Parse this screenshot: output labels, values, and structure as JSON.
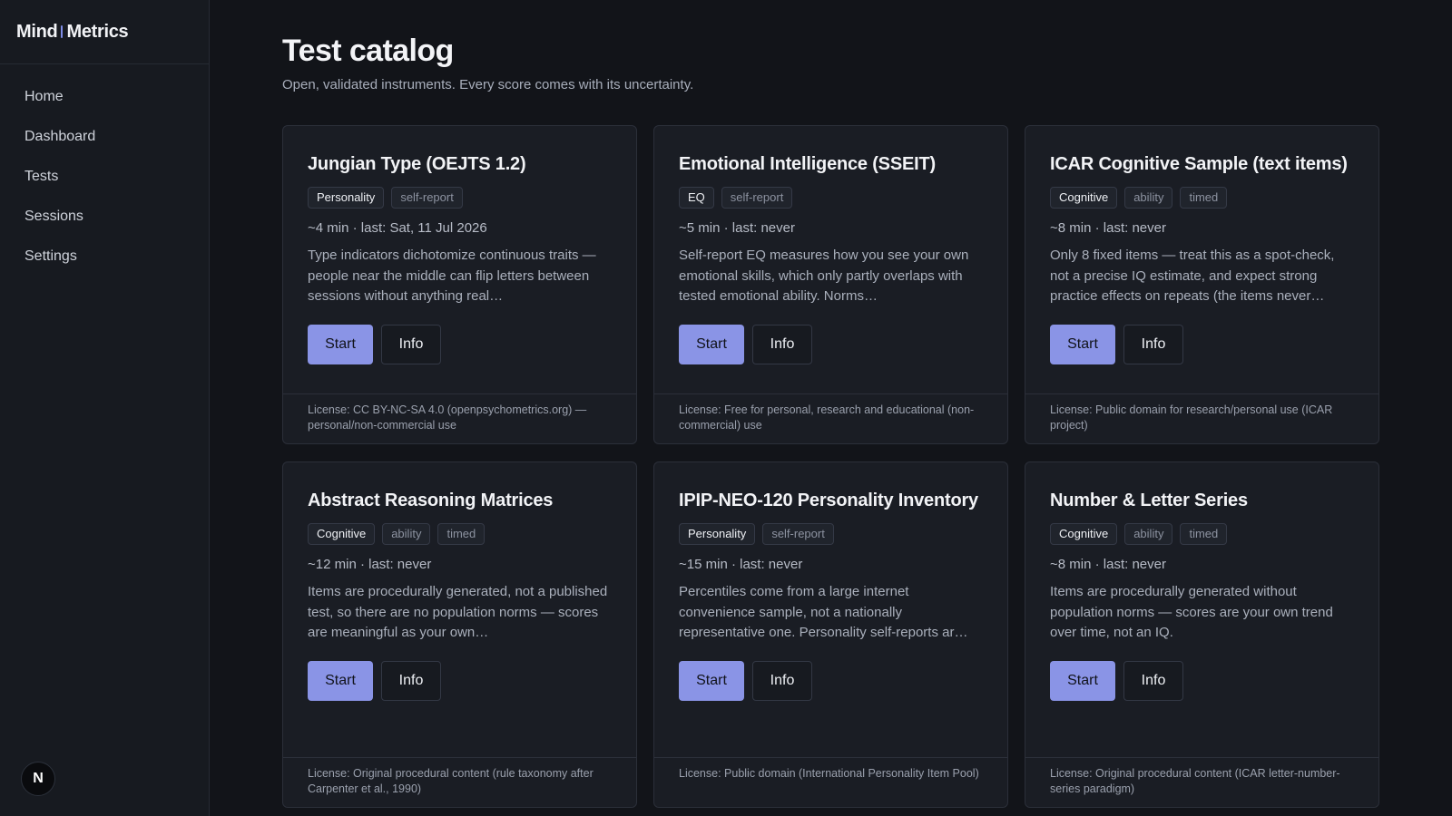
{
  "brand": {
    "part1": "Mind",
    "part2": "Metrics"
  },
  "nav": [
    {
      "label": "Home"
    },
    {
      "label": "Dashboard"
    },
    {
      "label": "Tests"
    },
    {
      "label": "Sessions"
    },
    {
      "label": "Settings"
    }
  ],
  "user": {
    "initial": "N"
  },
  "page": {
    "title": "Test catalog",
    "subtitle": "Open, validated instruments. Every score comes with its uncertainty."
  },
  "buttons": {
    "start": "Start",
    "info": "Info"
  },
  "cards": [
    {
      "title": "Jungian Type (OEJTS 1.2)",
      "tags": [
        "Personality",
        "self-report"
      ],
      "meta": "~4 min · last: Sat, 11 Jul 2026",
      "description": "Type indicators dichotomize continuous traits — people near the middle can flip letters between sessions without anything real…",
      "license": "License: CC BY-NC-SA 4.0 (openpsychometrics.org) — personal/non-commercial use"
    },
    {
      "title": "Emotional Intelligence (SSEIT)",
      "tags": [
        "EQ",
        "self-report"
      ],
      "meta": "~5 min · last: never",
      "description": "Self-report EQ measures how you see your own emotional skills, which only partly overlaps with tested emotional ability. Norms…",
      "license": "License: Free for personal, research and educational (non-commercial) use"
    },
    {
      "title": "ICAR Cognitive Sample (text items)",
      "tags": [
        "Cognitive",
        "ability",
        "timed"
      ],
      "meta": "~8 min · last: never",
      "description": "Only 8 fixed items — treat this as a spot-check, not a precise IQ estimate, and expect strong practice effects on repeats (the items never…",
      "license": "License: Public domain for research/personal use (ICAR project)"
    },
    {
      "title": "Abstract Reasoning Matrices",
      "tags": [
        "Cognitive",
        "ability",
        "timed"
      ],
      "meta": "~12 min · last: never",
      "description": "Items are procedurally generated, not a published test, so there are no population norms — scores are meaningful as your own…",
      "license": "License: Original procedural content (rule taxonomy after Carpenter et al., 1990)"
    },
    {
      "title": "IPIP-NEO-120 Personality Inventory",
      "tags": [
        "Personality",
        "self-report"
      ],
      "meta": "~15 min · last: never",
      "description": "Percentiles come from a large internet convenience sample, not a nationally representative one. Personality self-reports ar…",
      "license": "License: Public domain (International Personality Item Pool)"
    },
    {
      "title": "Number & Letter Series",
      "tags": [
        "Cognitive",
        "ability",
        "timed"
      ],
      "meta": "~8 min · last: never",
      "description": "Items are procedurally generated without population norms — scores are your own trend over time, not an IQ.",
      "license": "License: Original procedural content (ICAR letter-number-series paradigm)"
    }
  ]
}
